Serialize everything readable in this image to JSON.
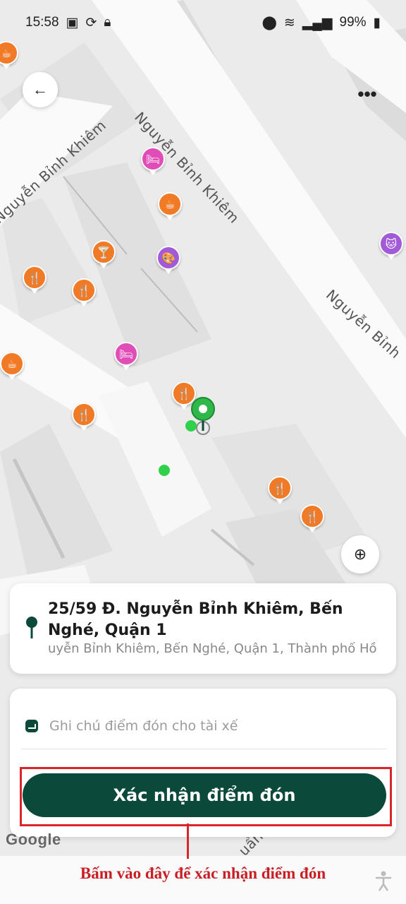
{
  "status_bar": {
    "time": "15:58",
    "battery": "99%"
  },
  "map": {
    "road_labels": [
      "Nguyễn Bỉnh Khiêm",
      "Nguyễn Bỉnh Khiêm",
      "Nguyễn Bỉnh",
      "Nguyễn Bỉnh Khiêm",
      "uẩn"
    ],
    "google_logo": "Google"
  },
  "address_card": {
    "title": "25/59 Đ. Nguyễn Bỉnh Khiêm, Bến Nghé, Quận 1",
    "subtitle": "uyễn Bỉnh Khiêm, Bến Nghé, Quận 1, Thành phố Hồ"
  },
  "sheet": {
    "note_placeholder": "Ghi chú điểm đón cho tài xế",
    "confirm_label": "Xác nhận điểm đón"
  },
  "annotation": {
    "callout": "Bấm vào đây để xác nhận điểm đón",
    "color": "#d8262c"
  },
  "colors": {
    "primary": "#0b4a3a",
    "pin_green": "#2eb84a",
    "poi_orange": "#f07a26",
    "poi_pink": "#e14db6",
    "poi_purple": "#a25ad6"
  }
}
